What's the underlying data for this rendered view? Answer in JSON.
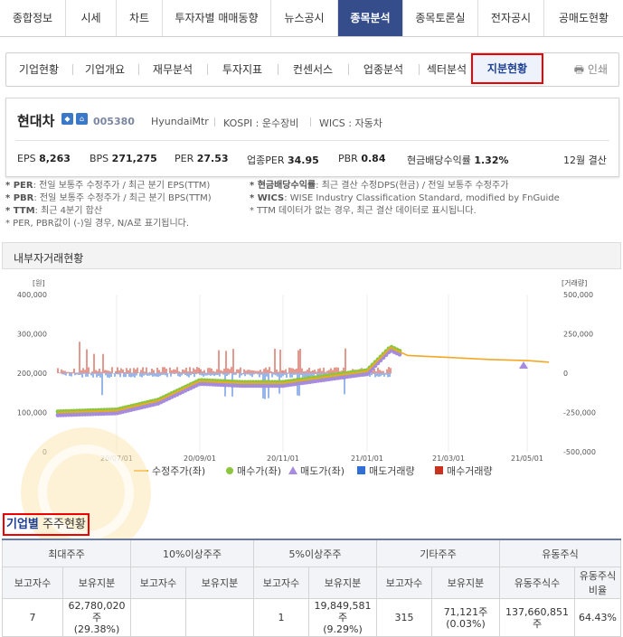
{
  "top_nav": [
    "종합정보",
    "시세",
    "차트",
    "투자자별 매매동향",
    "뉴스공시",
    "종목분석",
    "종목토론실",
    "전자공시",
    "공매도현황"
  ],
  "sub_nav": [
    "기업현황",
    "기업개요",
    "재무분석",
    "투자지표",
    "컨센서스",
    "업종분석",
    "섹터분석",
    "지분현황"
  ],
  "print_label": "인쇄",
  "company": {
    "name": "현대차",
    "code": "005380",
    "eng": "HyundaiMtr",
    "market": "KOSPI : 운수장비",
    "wics": "WICS : 자동차"
  },
  "metrics": {
    "eps_label": "EPS",
    "eps": "8,263",
    "bps_label": "BPS",
    "bps": "271,275",
    "per_label": "PER",
    "per": "27.53",
    "iper_label": "업종PER",
    "iper": "34.95",
    "pbr_label": "PBR",
    "pbr": "0.84",
    "div_label": "현금배당수익률",
    "div": "1.32%",
    "settle": "12월 결산"
  },
  "notes": {
    "n1_k": "* PER",
    "n1": ": 전일 보통주 수정주가 / 최근 분기 EPS(TTM)",
    "n2_k": "* PBR",
    "n2": ": 전일 보통주 수정주가 / 최근 분기 BPS(TTM)",
    "n3_k": "* TTM",
    "n3": ": 최근 4분기 합산",
    "n4": "* PER, PBR값이 (-)일 경우, N/A로 표기됩니다.",
    "n5_k": "* 현금배당수익률",
    "n5": ": 최근 결산 수정DPS(현금) / 전일 보통주 수정주가",
    "n6_k": "* WICS",
    "n6": ": WISE Industry Classification Standard, modified by FnGuide",
    "n7": "* TTM 데이터가 없는 경우, 최근 결산 데이터로 표시됩니다."
  },
  "chart_section_title": "내부자거래현황",
  "chart_data": {
    "type": "line",
    "left_unit": "[원]",
    "right_unit": "[거래량]",
    "left_ticks": [
      "400,000",
      "300,000",
      "200,000",
      "100,000",
      "0"
    ],
    "right_ticks": [
      "500,000",
      "250,000",
      "0",
      "-250,000",
      "-500,000"
    ],
    "ylim_left": [
      0,
      400000
    ],
    "ylim_right": [
      -500000,
      500000
    ],
    "x_ticks": [
      "20/07/01",
      "20/09/01",
      "20/11/01",
      "21/01/01",
      "21/03/01",
      "21/05/01"
    ],
    "legend": [
      "수정주가(좌)",
      "매수가(좌)",
      "매도가(좌)",
      "매도거래량",
      "매수거래량"
    ],
    "colors": {
      "price": "#f5a623",
      "buy": "#8cc63f",
      "sell": "#a78bde",
      "sellvol": "#2f6fd6",
      "buyvol": "#c8321e"
    },
    "series": [
      {
        "name": "수정주가(좌)",
        "x": [
          "20/06",
          "20/07/01",
          "20/08/01",
          "20/09/01",
          "20/10/01",
          "20/11/01",
          "20/12/01",
          "21/01/01",
          "21/01/15",
          "21/02/01",
          "21/03/01",
          "21/04/01",
          "21/05/01",
          "21/06"
        ],
        "values": [
          100000,
          105000,
          130000,
          180000,
          175000,
          175000,
          190000,
          205000,
          265000,
          245000,
          240000,
          235000,
          232000,
          228000
        ]
      }
    ]
  },
  "shareholder_title_1": "기업별",
  "shareholder_title_2": "주주현황",
  "table": {
    "groups": [
      "최대주주",
      "10%이상주주",
      "5%이상주주",
      "기타주주",
      "유동주식"
    ],
    "sub": [
      "보고자수",
      "보유지분",
      "보고자수",
      "보유지분",
      "보고자수",
      "보유지분",
      "보고자수",
      "보유지분",
      "유동주식수",
      "유동주식비율"
    ],
    "row": [
      "7",
      "62,780,020주",
      "(29.38%)",
      "",
      "",
      "1",
      "19,849,581주",
      "(9.29%)",
      "315",
      "71,121주",
      "(0.03%)",
      "137,660,851주",
      "64.43%"
    ]
  }
}
